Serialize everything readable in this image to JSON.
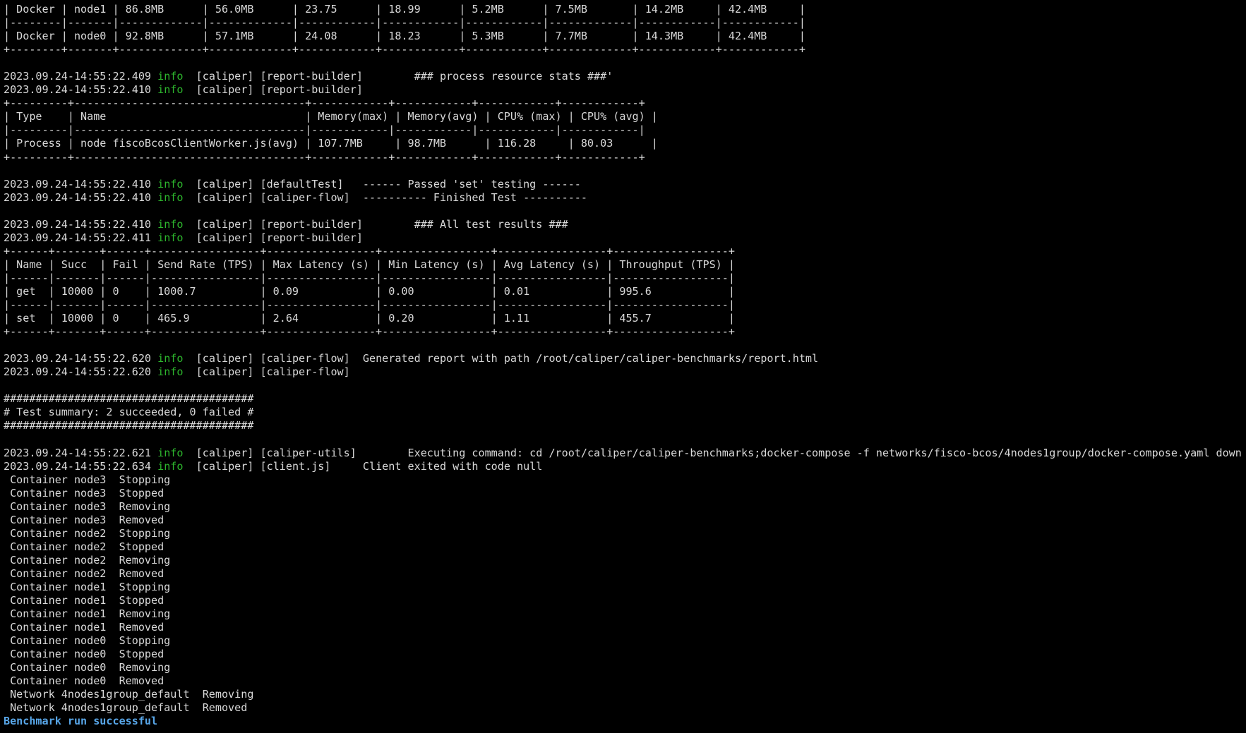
{
  "colors": {
    "background": "#000000",
    "text": "#d9d9d9",
    "info_level": "#2db52d",
    "success": "#58a6e8"
  },
  "lines": [
    {
      "type": "text",
      "text": "| Docker | node1 | 86.8MB      | 56.0MB      | 23.75      | 18.99      | 5.2MB      | 7.5MB       | 14.2MB     | 42.4MB     |"
    },
    {
      "type": "text",
      "text": "|--------|-------|-------------|-------------|------------|------------|------------|-------------|------------|------------|"
    },
    {
      "type": "text",
      "text": "| Docker | node0 | 92.8MB      | 57.1MB      | 24.08      | 18.23      | 5.3MB      | 7.7MB       | 14.3MB     | 42.4MB     |"
    },
    {
      "type": "text",
      "text": "+--------+-------+-------------+-------------+------------+------------+------------+-------------+------------+------------+"
    },
    {
      "type": "blank"
    },
    {
      "type": "log",
      "timestamp": "2023.09.24-14:55:22.409",
      "level": "info",
      "rest": "  [caliper] [report-builder]        ### process resource stats ###'"
    },
    {
      "type": "log",
      "timestamp": "2023.09.24-14:55:22.410",
      "level": "info",
      "rest": "  [caliper] [report-builder]"
    },
    {
      "type": "text",
      "text": "+---------+------------------------------------+------------+------------+------------+------------+"
    },
    {
      "type": "text",
      "text": "| Type    | Name                               | Memory(max) | Memory(avg) | CPU% (max) | CPU% (avg) |"
    },
    {
      "type": "text",
      "text": "|---------|------------------------------------|------------|------------|------------|------------|"
    },
    {
      "type": "text",
      "text": "| Process | node fiscoBcosClientWorker.js(avg) | 107.7MB     | 98.7MB      | 116.28     | 80.03      |"
    },
    {
      "type": "text",
      "text": "+---------+------------------------------------+------------+------------+------------+------------+"
    },
    {
      "type": "blank"
    },
    {
      "type": "log",
      "timestamp": "2023.09.24-14:55:22.410",
      "level": "info",
      "rest": "  [caliper] [defaultTest]   ------ Passed 'set' testing ------"
    },
    {
      "type": "log",
      "timestamp": "2023.09.24-14:55:22.410",
      "level": "info",
      "rest": "  [caliper] [caliper-flow]  ---------- Finished Test ----------"
    },
    {
      "type": "blank"
    },
    {
      "type": "log",
      "timestamp": "2023.09.24-14:55:22.410",
      "level": "info",
      "rest": "  [caliper] [report-builder]        ### All test results ###"
    },
    {
      "type": "log",
      "timestamp": "2023.09.24-14:55:22.411",
      "level": "info",
      "rest": "  [caliper] [report-builder]"
    },
    {
      "type": "text",
      "text": "+------+-------+------+-----------------+-----------------+-----------------+-----------------+------------------+"
    },
    {
      "type": "text",
      "text": "| Name | Succ  | Fail | Send Rate (TPS) | Max Latency (s) | Min Latency (s) | Avg Latency (s) | Throughput (TPS) |"
    },
    {
      "type": "text",
      "text": "|------|-------|------|-----------------|-----------------|-----------------|-----------------|------------------|"
    },
    {
      "type": "text",
      "text": "| get  | 10000 | 0    | 1000.7          | 0.09            | 0.00            | 0.01            | 995.6            |"
    },
    {
      "type": "text",
      "text": "|------|-------|------|-----------------|-----------------|-----------------|-----------------|------------------|"
    },
    {
      "type": "text",
      "text": "| set  | 10000 | 0    | 465.9           | 2.64            | 0.20            | 1.11            | 455.7            |"
    },
    {
      "type": "text",
      "text": "+------+-------+------+-----------------+-----------------+-----------------+-----------------+------------------+"
    },
    {
      "type": "blank"
    },
    {
      "type": "log",
      "timestamp": "2023.09.24-14:55:22.620",
      "level": "info",
      "rest": "  [caliper] [caliper-flow]  Generated report with path /root/caliper/caliper-benchmarks/report.html"
    },
    {
      "type": "log",
      "timestamp": "2023.09.24-14:55:22.620",
      "level": "info",
      "rest": "  [caliper] [caliper-flow]"
    },
    {
      "type": "blank"
    },
    {
      "type": "text",
      "text": "#######################################"
    },
    {
      "type": "text",
      "text": "# Test summary: 2 succeeded, 0 failed #"
    },
    {
      "type": "text",
      "text": "#######################################"
    },
    {
      "type": "blank"
    },
    {
      "type": "log",
      "timestamp": "2023.09.24-14:55:22.621",
      "level": "info",
      "rest": "  [caliper] [caliper-utils]        Executing command: cd /root/caliper/caliper-benchmarks;docker-compose -f networks/fisco-bcos/4nodes1group/docker-compose.yaml down"
    },
    {
      "type": "log",
      "timestamp": "2023.09.24-14:55:22.634",
      "level": "info",
      "rest": "  [caliper] [client.js]     Client exited with code null"
    },
    {
      "type": "text",
      "text": " Container node3  Stopping"
    },
    {
      "type": "text",
      "text": " Container node3  Stopped"
    },
    {
      "type": "text",
      "text": " Container node3  Removing"
    },
    {
      "type": "text",
      "text": " Container node3  Removed"
    },
    {
      "type": "text",
      "text": " Container node2  Stopping"
    },
    {
      "type": "text",
      "text": " Container node2  Stopped"
    },
    {
      "type": "text",
      "text": " Container node2  Removing"
    },
    {
      "type": "text",
      "text": " Container node2  Removed"
    },
    {
      "type": "text",
      "text": " Container node1  Stopping"
    },
    {
      "type": "text",
      "text": " Container node1  Stopped"
    },
    {
      "type": "text",
      "text": " Container node1  Removing"
    },
    {
      "type": "text",
      "text": " Container node1  Removed"
    },
    {
      "type": "text",
      "text": " Container node0  Stopping"
    },
    {
      "type": "text",
      "text": " Container node0  Stopped"
    },
    {
      "type": "text",
      "text": " Container node0  Removing"
    },
    {
      "type": "text",
      "text": " Container node0  Removed"
    },
    {
      "type": "text",
      "text": " Network 4nodes1group_default  Removing"
    },
    {
      "type": "text",
      "text": " Network 4nodes1group_default  Removed"
    },
    {
      "type": "success",
      "text": "Benchmark run successful"
    }
  ]
}
